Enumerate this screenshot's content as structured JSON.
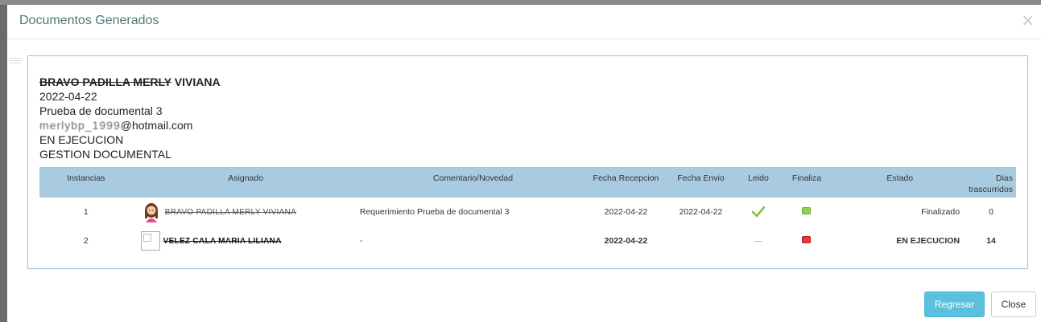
{
  "modal": {
    "title": "Documentos Generados",
    "close_symbol": "×"
  },
  "info": {
    "name_struck": "BRAVO PADILLA MERLY",
    "name_rest": "VIVIANA",
    "date": "2022-04-22",
    "document": "Prueba de documental 3",
    "email_obscured": "merlybp_1999",
    "email_domain": "@hotmail.com",
    "status": "EN EJECUCION",
    "area": "GESTION DOCUMENTAL"
  },
  "table": {
    "headers": {
      "instancias": "Instancias",
      "asignado": "Asignado",
      "comentario": "Comentario/Novedad",
      "fecha_recepcion": "Fecha Recepcion",
      "fecha_envio": "Fecha Envio",
      "leido": "Leido",
      "finaliza": "Finaliza",
      "estado": "Estado",
      "dias": "Dias trascurridos"
    },
    "rows": [
      {
        "instancia": "1",
        "asignado": "BRAVO PADILLA MERLY VIVIANA",
        "comentario": "Requerimiento Prueba de documental 3",
        "fecha_recepcion": "2022-04-22",
        "fecha_envio": "2022-04-22",
        "leido": "read",
        "finaliza": "green",
        "estado": "Finalizado",
        "dias": "0"
      },
      {
        "instancia": "2",
        "asignado": "VELEZ CALA MARIA LILIANA",
        "comentario": "-",
        "fecha_recepcion": "2022-04-22",
        "fecha_envio": "",
        "leido": "unread",
        "finaliza": "red",
        "estado": "EN EJECUCION",
        "dias": "14"
      }
    ]
  },
  "buttons": {
    "regresar": "Regresar",
    "close": "Close"
  },
  "icons": {
    "close": "close-icon",
    "check": "checkmark-icon",
    "avatar": "user-avatar-icon",
    "broken_image": "broken-image-icon"
  },
  "colors": {
    "title": "#4a7a78",
    "header_bg": "#a9cbe2",
    "primary_button": "#5bc0de",
    "finalized": "#8fd14f",
    "running": "#e8363b"
  }
}
